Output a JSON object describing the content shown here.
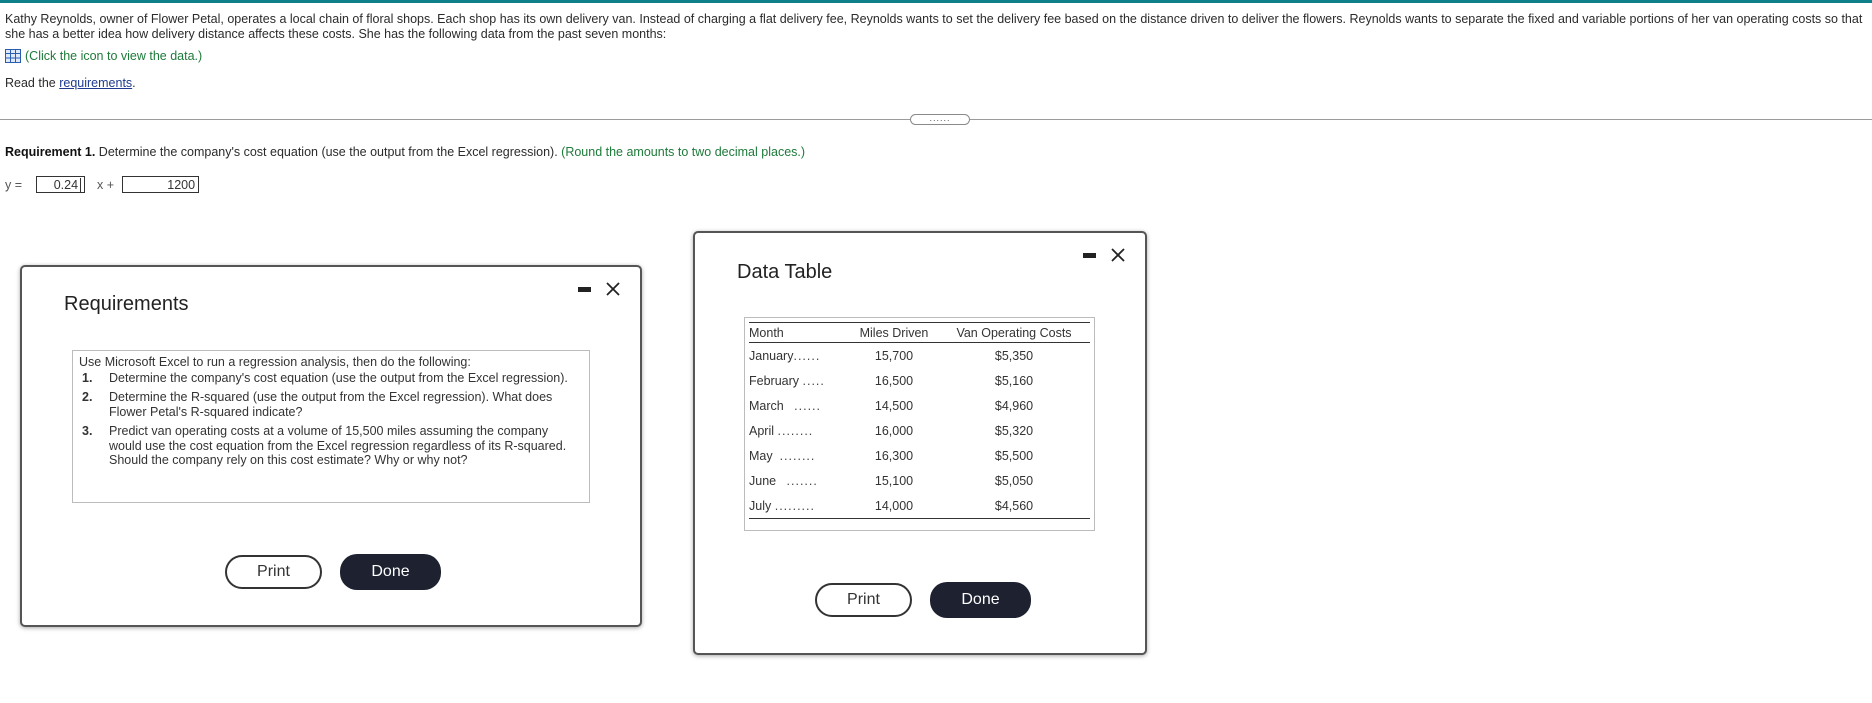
{
  "intro": {
    "text": "Kathy Reynolds, owner of Flower Petal, operates a local chain of floral shops. Each shop has its own delivery van. Instead of charging a flat delivery fee, Reynolds wants to set the delivery fee based on the distance driven to deliver the flowers. Reynolds wants to separate the fixed and variable portions of her van operating costs so that she has a better idea how delivery distance affects these costs. She has the following data from the past seven months:",
    "data_link": "(Click the icon to view the data.)",
    "read_prefix": "Read the",
    "read_link": "requirements",
    "read_suffix": "."
  },
  "handle_label": "......",
  "requirement1": {
    "label": "Requirement 1.",
    "text": "Determine the company's cost equation (use the output from the Excel regression).",
    "hint": "(Round the amounts to two decimal places.)"
  },
  "equation": {
    "y_label": "y =",
    "x_label": "x +",
    "slope_value": "0.24",
    "intercept_value": "1200"
  },
  "requirements_modal": {
    "title": "Requirements",
    "intro": "Use Microsoft Excel to run a regression analysis, then do the following:",
    "items": [
      {
        "num": "1.",
        "text": "Determine the company's cost equation (use the output from the Excel regression)."
      },
      {
        "num": "2.",
        "text": "Determine the R-squared (use the output from the Excel regression). What does Flower Petal's R-squared indicate?"
      },
      {
        "num": "3.",
        "text": "Predict van operating costs at a volume of 15,500 miles assuming the company would use the cost equation from the Excel regression regardless of its R-squared. Should the company rely on this cost estimate? Why or why not?"
      }
    ],
    "print_label": "Print",
    "done_label": "Done"
  },
  "data_modal": {
    "title": "Data Table",
    "headers": {
      "month": "Month",
      "miles": "Miles Driven",
      "cost": "Van Operating Costs"
    },
    "rows": [
      {
        "month": "January",
        "dots": "......",
        "miles": "15,700",
        "cost": "$5,350"
      },
      {
        "month": "February",
        "dots": ".....",
        "miles": "16,500",
        "cost": "$5,160"
      },
      {
        "month": "March",
        "dots": "......",
        "miles": "14,500",
        "cost": "$4,960"
      },
      {
        "month": "April",
        "dots": "........",
        "miles": "16,000",
        "cost": "$5,320"
      },
      {
        "month": "May",
        "dots": "........",
        "miles": "16,300",
        "cost": "$5,500"
      },
      {
        "month": "June",
        "dots": ".......",
        "miles": "15,100",
        "cost": "$5,050"
      },
      {
        "month": "July",
        "dots": ".........",
        "miles": "14,000",
        "cost": "$4,560"
      }
    ],
    "print_label": "Print",
    "done_label": "Done"
  },
  "colors": {
    "accent_teal": "#0f7f8a",
    "hint_green": "#1e7a3a",
    "link_blue": "#1f3b8f",
    "button_dark": "#1d2130"
  },
  "icons": {
    "data_icon": "table-grid-icon",
    "minimize": "minimize-icon",
    "close": "close-icon"
  }
}
